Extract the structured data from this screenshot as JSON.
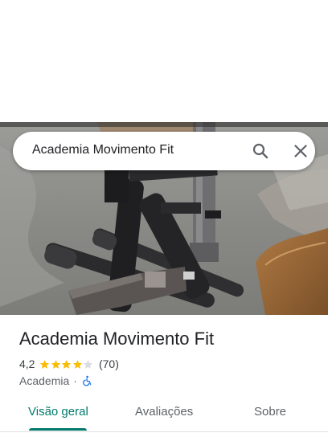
{
  "search": {
    "query": "Academia Movimento Fit"
  },
  "place": {
    "name": "Academia Movimento Fit",
    "rating": "4,2",
    "rating_value": 4.2,
    "review_count": "(70)",
    "category": "Academia",
    "separator": "·",
    "accessibility_icon": "wheelchair-accessible-icon"
  },
  "tabs": [
    {
      "label": "Visão geral",
      "active": true
    },
    {
      "label": "Avaliações",
      "active": false
    },
    {
      "label": "Sobre",
      "active": false
    }
  ],
  "icons": {
    "search": "search-icon",
    "close": "close-icon",
    "star": "star-icon"
  },
  "colors": {
    "accent": "#00796b",
    "star_filled": "#fbbc04",
    "star_empty": "#dadce0",
    "accessibility": "#1a73e8",
    "text_primary": "#202124",
    "text_secondary": "#5f6368"
  }
}
